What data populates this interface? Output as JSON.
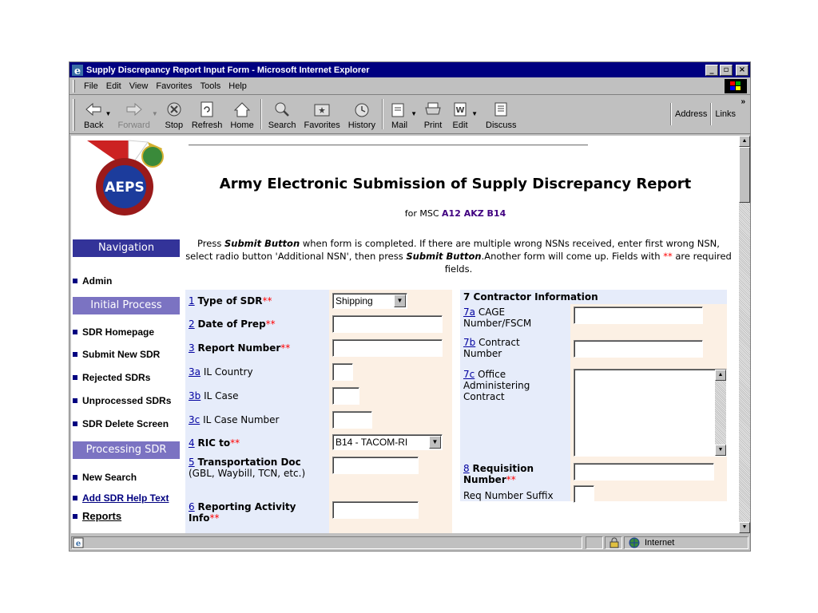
{
  "window": {
    "title": "Supply Discrepancy Report Input Form - Microsoft Internet Explorer",
    "controls": [
      "_",
      "8",
      "x"
    ]
  },
  "menu": [
    "File",
    "Edit",
    "View",
    "Favorites",
    "Tools",
    "Help"
  ],
  "toolbar": {
    "back": "Back",
    "forward": "Forward",
    "stop": "Stop",
    "refresh": "Refresh",
    "home": "Home",
    "search": "Search",
    "favorites": "Favorites",
    "history": "History",
    "mail": "Mail",
    "print": "Print",
    "edit": "Edit",
    "discuss": "Discuss",
    "address": "Address",
    "links": "Links"
  },
  "nav": {
    "logo_text": "AEPS",
    "navigation_header": "Navigation",
    "admin": "Admin",
    "initial_header": "Initial Process",
    "sdr_homepage": "SDR Homepage",
    "submit_new": "Submit New SDR",
    "rejected": "Rejected SDRs",
    "unprocessed": "Unprocessed SDRs",
    "delete_screen": "SDR Delete Screen",
    "processing_header": "Processing SDR",
    "new_search": "New Search",
    "help_text": "Add SDR Help Text",
    "reports": "Reports"
  },
  "colors": {
    "nav_header_dark": "#333399",
    "nav_header_light": "#7b73c2",
    "field_blue": "#e6ecfa",
    "field_peach": "#fcf0e4",
    "required": "#ff0000"
  },
  "main": {
    "title": "Army Electronic Submission of Supply Discrepancy Report",
    "msc_prefix": "for MSC",
    "msc_codes": "A12 AKZ B14",
    "instr_1": "Press",
    "instr_submit": "Submit Button",
    "instr_2": "when form is completed. If there are multiple wrong NSNs received, enter first wrong NSN, select radio button 'Additional NSN', then press",
    "instr_3": ".Another form will come up. Fields with",
    "instr_stars": "**",
    "instr_4": "are required fields."
  },
  "fields": {
    "f1_num": "1",
    "f1_label": "Type of SDR",
    "f1_value": "Shipping",
    "f2_num": "2",
    "f2_label": "Date of Prep",
    "f3_num": "3",
    "f3_label": "Report Number",
    "f3a_num": "3a",
    "f3a_label": "IL Country",
    "f3b_num": "3b",
    "f3b_label": "IL Case",
    "f3c_num": "3c",
    "f3c_label": "IL Case Number",
    "f4_num": "4",
    "f4_label": "RIC to",
    "f4_value": "B14 - TACOM-RI",
    "f5_num": "5",
    "f5_label": "Transportation Doc",
    "f5_sub": "(GBL, Waybill, TCN, etc.)",
    "f6_num": "6",
    "f6_label": "Reporting Activity Info",
    "f7_label": "7 Contractor Information",
    "f7a_num": "7a",
    "f7a_label": "CAGE Number/FSCM",
    "f7b_num": "7b",
    "f7b_label": "Contract Number",
    "f7c_num": "7c",
    "f7c_label": "Office Administering Contract",
    "f8_num": "8",
    "f8_label": "Requisition Number",
    "f8_suffix": "Req Number Suffix",
    "req": "**"
  },
  "status": {
    "zone": "Internet"
  }
}
